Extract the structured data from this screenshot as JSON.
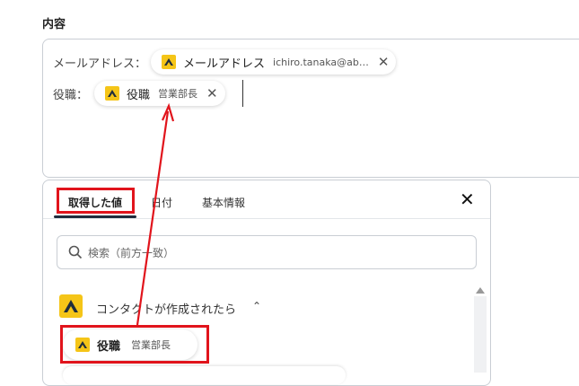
{
  "section": {
    "title": "内容"
  },
  "fields": [
    {
      "label": "メールアドレス：",
      "chip_name": "メールアドレス",
      "chip_value": "ichiro.tanaka@ab…"
    },
    {
      "label": "役職：",
      "chip_name": "役職",
      "chip_value": "営業部長"
    }
  ],
  "picker": {
    "tabs": [
      "取得した値",
      "日付",
      "基本情報"
    ],
    "close_label": "✕",
    "search_placeholder": "検索（前方一致）",
    "group": {
      "title": "コンタクトが作成されたら",
      "caret": "⌃"
    },
    "items": [
      {
        "name": "役職",
        "value": "営業部長"
      }
    ]
  },
  "chip_close": "✕",
  "colors": {
    "accent_red": "#e1141c",
    "logo_yellow": "#f5c518",
    "logo_dark": "#1f2d3d"
  },
  "icons": {
    "app": "app-logo-icon",
    "close": "close-icon",
    "search": "search-icon",
    "caret": "chevron-up-icon"
  }
}
